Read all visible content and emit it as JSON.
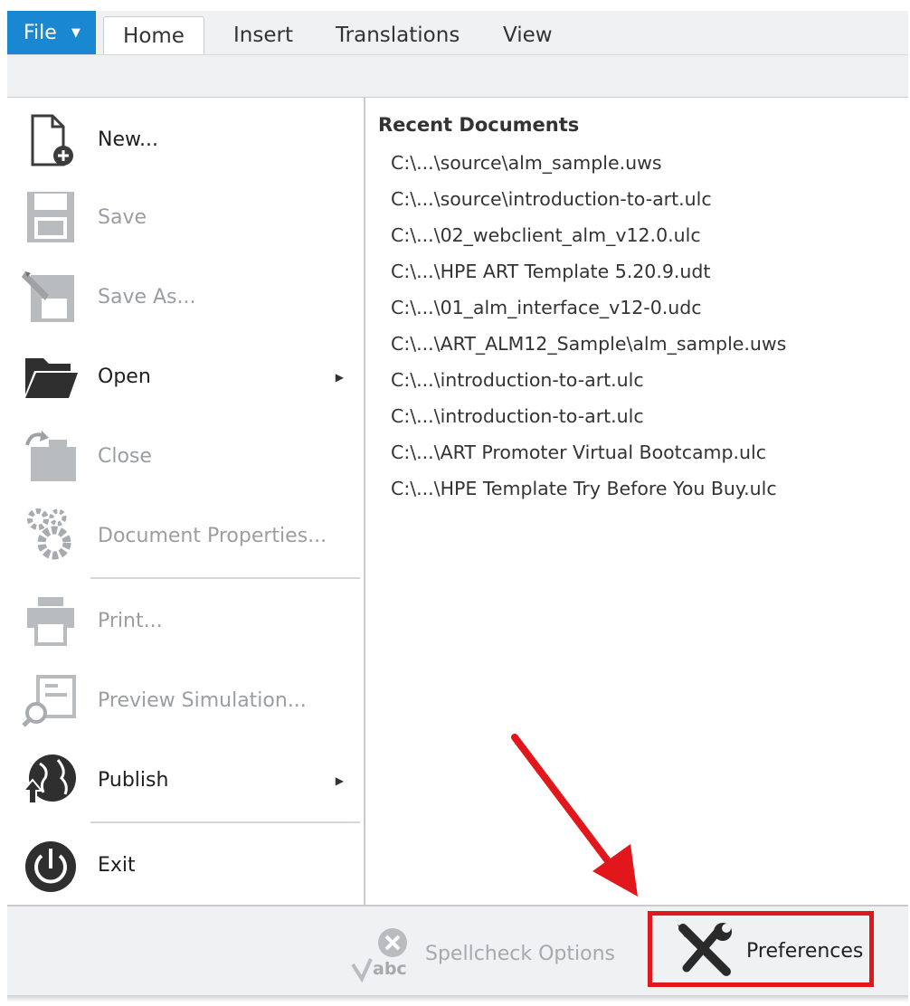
{
  "tabs": {
    "file_label": "File",
    "home": "Home",
    "insert": "Insert",
    "translations": "Translations",
    "view": "View"
  },
  "menu": {
    "new": "New...",
    "save": "Save",
    "save_as": "Save As...",
    "open": "Open",
    "close": "Close",
    "document_properties": "Document Properties...",
    "print": "Print...",
    "preview_simulation": "Preview Simulation...",
    "publish": "Publish",
    "exit": "Exit"
  },
  "recent": {
    "title": "Recent Documents",
    "items": [
      "C:\\...\\source\\alm_sample.uws",
      "C:\\...\\source\\introduction-to-art.ulc",
      "C:\\...\\02_webclient_alm_v12.0.ulc",
      "C:\\...\\HPE ART Template 5.20.9.udt",
      "C:\\...\\01_alm_interface_v12-0.udc",
      "C:\\...\\ART_ALM12_Sample\\alm_sample.uws",
      "C:\\...\\introduction-to-art.ulc",
      "C:\\...\\introduction-to-art.ulc",
      "C:\\...\\ART Promoter Virtual Bootcamp.ulc",
      "C:\\...\\HPE Template Try Before You Buy.ulc"
    ]
  },
  "bottom": {
    "spellcheck_options": "Spellcheck Options",
    "spellcheck_icon_text": "abc",
    "preferences": "Preferences"
  },
  "colors": {
    "file_button": "#1a87d3",
    "highlight_box": "#e1171b",
    "disabled_text": "#9a9ea2"
  },
  "icons": {
    "new": "new-document-icon",
    "save": "floppy-disk-icon",
    "save_as": "save-as-icon",
    "open": "open-folder-icon",
    "close": "close-folder-icon",
    "document_properties": "gears-icon",
    "print": "printer-icon",
    "preview_simulation": "preview-icon",
    "publish": "globe-publish-icon",
    "exit": "power-icon",
    "spellcheck": "spellcheck-icon",
    "preferences": "tools-icon"
  }
}
